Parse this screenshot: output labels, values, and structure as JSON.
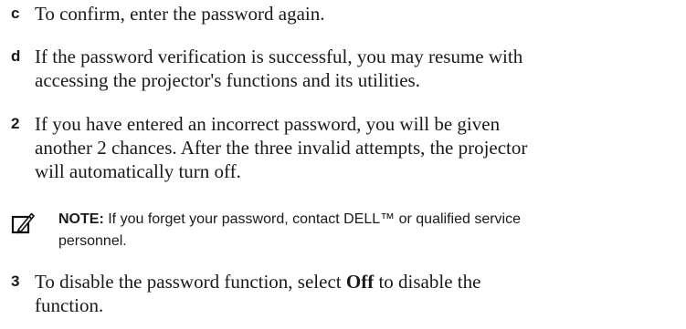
{
  "step_c": {
    "marker": "c",
    "lines": [
      "To confirm, enter the password again."
    ]
  },
  "step_d": {
    "marker": "d",
    "lines": [
      "If the password verification is successful, you may resume with",
      "accessing the projector's functions and its utilities."
    ]
  },
  "step_2": {
    "marker": "2",
    "lines": [
      "If you have entered an incorrect password, you will be given",
      "another 2 chances. After the three invalid attempts, the projector",
      "will automatically turn off."
    ]
  },
  "note": {
    "icon": "pencil-note-icon",
    "label": "NOTE:",
    "line1": "If you forget your password, contact DELL™ or qualified service",
    "line2": "personnel."
  },
  "step_3": {
    "marker": "3",
    "line1_before": "To disable the password function, select ",
    "line1_bold": "Off",
    "line1_after": " to disable the",
    "line2": "function."
  }
}
